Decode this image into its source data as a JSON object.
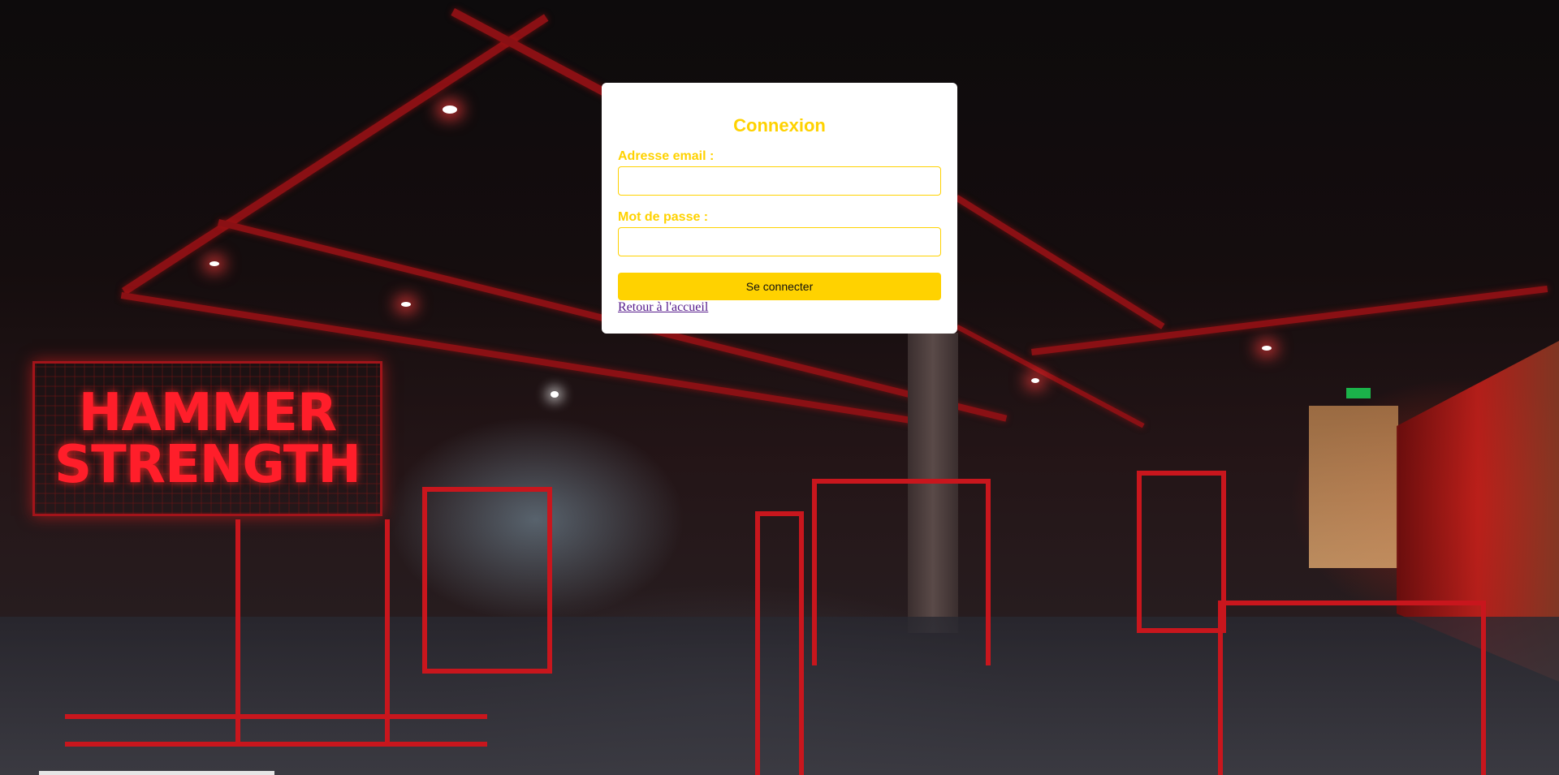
{
  "background": {
    "sign_line1": "HAMMER",
    "sign_line2": "STRENGTH"
  },
  "login": {
    "title": "Connexion",
    "email_label": "Adresse email :",
    "email_value": "",
    "password_label": "Mot de passe :",
    "password_value": "",
    "submit_label": "Se connecter",
    "back_link": "Retour à l'accueil"
  },
  "colors": {
    "accent": "#ffd200",
    "card_bg": "#ffffff",
    "link": "#551a8b"
  }
}
